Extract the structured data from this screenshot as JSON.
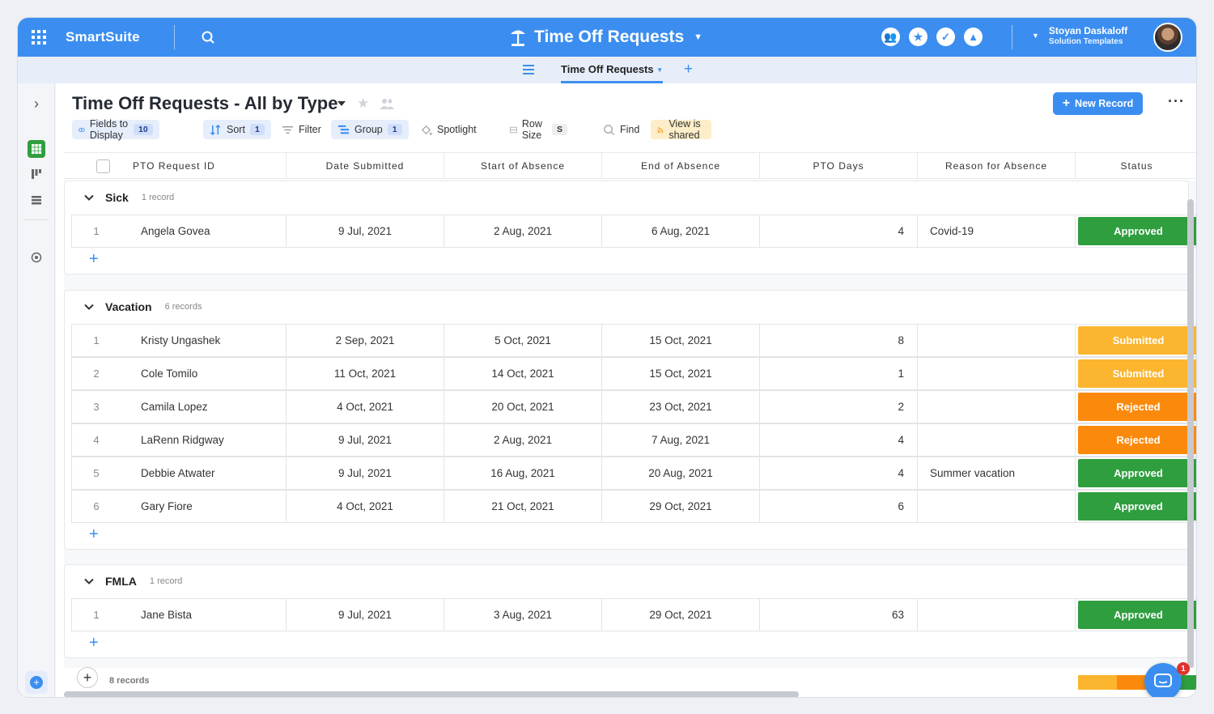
{
  "topbar": {
    "brand": "SmartSuite",
    "app_title": "Time Off Requests",
    "user_name": "Stoyan Daskaloff",
    "user_sub": "Solution Templates"
  },
  "subbar": {
    "tab_label": "Time Off Requests"
  },
  "view": {
    "title": "Time Off Requests - All by Type",
    "new_record": "New Record"
  },
  "toolbar": {
    "fields_label": "Fields to Display",
    "fields_count": "10",
    "sort_label": "Sort",
    "sort_count": "1",
    "filter_label": "Filter",
    "group_label": "Group",
    "group_count": "1",
    "spotlight_label": "Spotlight",
    "rowsize_label": "Row Size",
    "rowsize_value": "S",
    "find_label": "Find",
    "shared_label": "View is shared"
  },
  "columns": [
    "PTO Request ID",
    "Date Submitted",
    "Start of Absence",
    "End of Absence",
    "PTO Days",
    "Reason for Absence",
    "Status"
  ],
  "status_colors": {
    "Approved": "#2f9e3f",
    "Submitted": "#fbb52f",
    "Rejected": "#fb8a0c"
  },
  "groups": [
    {
      "name": "Sick",
      "count": "1 record",
      "rows": [
        {
          "num": "1",
          "name": "Angela Govea",
          "submitted": "9 Jul, 2021",
          "start": "2 Aug, 2021",
          "end": "6 Aug, 2021",
          "pto": "4",
          "reason": "Covid-19",
          "status": "Approved"
        }
      ]
    },
    {
      "name": "Vacation",
      "count": "6 records",
      "rows": [
        {
          "num": "1",
          "name": "Kristy Ungashek",
          "submitted": "2 Sep, 2021",
          "start": "5 Oct, 2021",
          "end": "15 Oct, 2021",
          "pto": "8",
          "reason": "",
          "status": "Submitted"
        },
        {
          "num": "2",
          "name": "Cole Tomilo",
          "submitted": "11 Oct, 2021",
          "start": "14 Oct, 2021",
          "end": "15 Oct, 2021",
          "pto": "1",
          "reason": "",
          "status": "Submitted"
        },
        {
          "num": "3",
          "name": "Camila Lopez",
          "submitted": "4 Oct, 2021",
          "start": "20 Oct, 2021",
          "end": "23 Oct, 2021",
          "pto": "2",
          "reason": "",
          "status": "Rejected"
        },
        {
          "num": "4",
          "name": "LaRenn Ridgway",
          "submitted": "9 Jul, 2021",
          "start": "2 Aug, 2021",
          "end": "7 Aug, 2021",
          "pto": "4",
          "reason": "",
          "status": "Rejected"
        },
        {
          "num": "5",
          "name": "Debbie Atwater",
          "submitted": "9 Jul, 2021",
          "start": "16 Aug, 2021",
          "end": "20 Aug, 2021",
          "pto": "4",
          "reason": "Summer vacation",
          "status": "Approved"
        },
        {
          "num": "6",
          "name": "Gary Fiore",
          "submitted": "4 Oct, 2021",
          "start": "21 Oct, 2021",
          "end": "29 Oct, 2021",
          "pto": "6",
          "reason": "",
          "status": "Approved"
        }
      ]
    },
    {
      "name": "FMLA",
      "count": "1 record",
      "rows": [
        {
          "num": "1",
          "name": "Jane Bista",
          "submitted": "9 Jul, 2021",
          "start": "3 Aug, 2021",
          "end": "29 Oct, 2021",
          "pto": "63",
          "reason": "",
          "status": "Approved"
        }
      ]
    }
  ],
  "footer": {
    "record_count": "8 records"
  },
  "chat_badge": "1"
}
